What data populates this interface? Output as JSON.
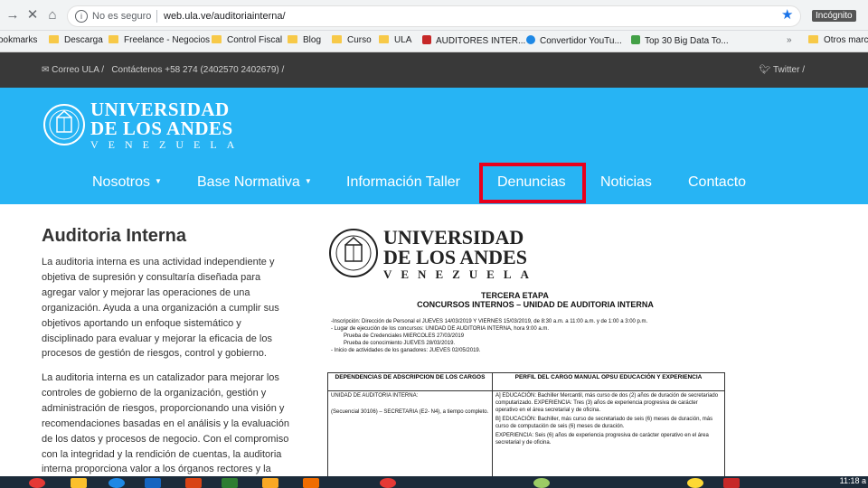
{
  "browser": {
    "security_label": "No es seguro",
    "url": "web.ula.ve/auditoriainterna/",
    "incognito_label": "Incógnito",
    "bookmarks": [
      {
        "label": "ookmarks",
        "type": "folder-less"
      },
      {
        "label": "Descarga",
        "type": "folder"
      },
      {
        "label": "Freelance - Negocios",
        "type": "folder"
      },
      {
        "label": "Control Fiscal",
        "type": "folder"
      },
      {
        "label": "Blog",
        "type": "folder"
      },
      {
        "label": "Curso",
        "type": "folder"
      },
      {
        "label": "ULA",
        "type": "folder"
      },
      {
        "label": "AUDITORES INTER...",
        "type": "site"
      },
      {
        "label": "Convertidor YouTu...",
        "type": "site"
      },
      {
        "label": "Top 30 Big Data To...",
        "type": "site"
      },
      {
        "label": "Otros marca",
        "type": "folder"
      }
    ],
    "overflow_label": "»"
  },
  "site_top": {
    "email_label": "Correo ULA",
    "contact_label": "Contáctenos +58 274 (2402570 2402679)",
    "twitter_label": "Twitter"
  },
  "header": {
    "logo_line1": "UNIVERSIDAD",
    "logo_line2": "DE LOS ANDES",
    "logo_line3": "VENEZUELA",
    "nav": [
      {
        "label": "Nosotros",
        "dropdown": true
      },
      {
        "label": "Base Normativa",
        "dropdown": true
      },
      {
        "label": "Información Taller",
        "dropdown": false
      },
      {
        "label": "Denuncias",
        "dropdown": false,
        "highlighted": true
      },
      {
        "label": "Noticias",
        "dropdown": false
      },
      {
        "label": "Contacto",
        "dropdown": false
      }
    ],
    "caret": "▼"
  },
  "content": {
    "title": "Auditoria Interna",
    "para1": "La auditoria interna es una actividad independiente y objetiva de supresión y consultaría diseñada para agregar valor y mejorar las operaciones de una organización. Ayuda a una organización a cumplir sus objetivos aportando un enfoque sistemático y disciplinado para evaluar y mejorar la eficacia de los procesos de gestión de riesgos, control y gobierno.",
    "para2": "La auditoria interna es un catalizador para mejorar los controles de gobierno de la organización, gestión y administración de riesgos, proporcionando una visión y recomendaciones basadas en el análisis y la evaluación de los datos y procesos de negocio. Con el compromiso con la integridad y la rendición de cuentas, la auditoria interna proporciona valor a los órganos rectores y la"
  },
  "document": {
    "logo_line1": "UNIVERSIDAD",
    "logo_line2": "DE LOS ANDES",
    "logo_line3": "VENEZUELA",
    "heading1": "TERCERA ETAPA",
    "heading2": "CONCURSOS INTERNOS – UNIDAD DE AUDITORIA INTERNA",
    "items": [
      "-Inscripción: Dirección de Personal el JUEVES 14/03/2019 Y VIERNES 15/03/2019, de 8:30 a.m. a 11:00 a.m. y de 1:00 a 3:00 p.m.",
      "- Lugar de ejecución de los concursos: UNIDAD DE AUDITORIA INTERNA, hora 9:00 a.m.",
      "Prueba de Credenciales MIERCOLES 27/03/2019",
      "Prueba de conocimiento JUEVES 28/03/2019.",
      "- Inicio de actividades de los ganadores: JUEVES 02/05/2019."
    ],
    "table": {
      "col1_header": "DEPENDENCIAS DE ADSCRIPCION DE LOS CARGOS",
      "col2_header": "PERFIL DEL CARGO MANUAL OPSU EDUCACIÓN Y EXPERIENCIA",
      "col1_row1": "UNIDAD DE AUDITORIA INTERNA:",
      "col1_row2": "(Secuencial 30106) – SECRETARIA (E2- N4), a tiempo completo.",
      "col2_a": "A] EDUCACIÓN: Bachiller Mercantil, más curso de dos (2) años de duración de secretariado computarizado. EXPERIENCIA: Tres (3) años de experiencia progresiva de carácter operativo en el área secretarial y de oficina.",
      "col2_b": "B] EDUCACIÓN: Bachiller, más curso de secretariado de seis (6) meses de duración, más curso de computación de seis (6) meses de duración.",
      "col2_c": "EXPERIENCIA: Seis (6) años de experiencia progresiva de carácter operativo en el área secretarial y de oficina."
    }
  },
  "taskbar": {
    "time": "11:18 a"
  },
  "colors": {
    "header_blue": "#27b4f4",
    "topbar_dark": "#393939",
    "highlight_red": "#e8001c"
  }
}
